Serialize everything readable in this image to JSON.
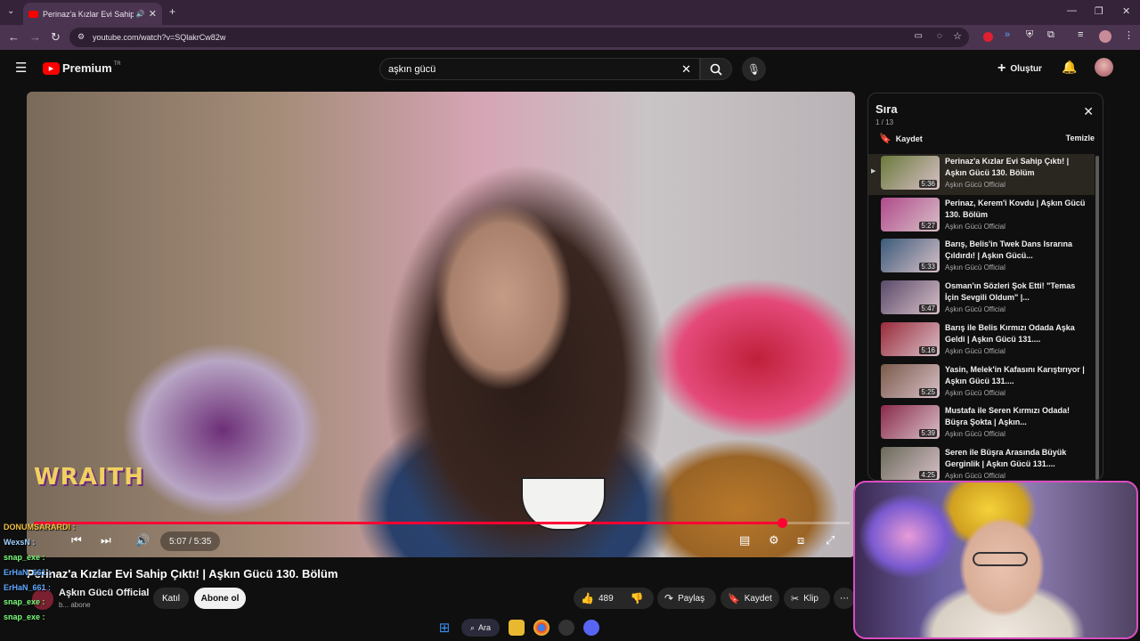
{
  "browser": {
    "tab_title": "Perinaz'a Kızlar Evi Sahip Çıkt",
    "url": "youtube.com/watch?v=SQlakrCw82w"
  },
  "youtube": {
    "logo_text": "Premium",
    "region": "TR",
    "search_value": "aşkın gücü",
    "create_label": "Oluştur"
  },
  "player": {
    "overlay_logo": "WRAITH",
    "time": "5:07 / 5:35",
    "progress": 0.917
  },
  "video": {
    "title": "Perinaz'a Kızlar Evi Sahip Çıktı! | Aşkın Gücü 130. Bölüm",
    "channel": "Aşkın Gücü Official",
    "subscribers": "b... abone",
    "join_label": "Katıl",
    "subscribe_label": "Abone ol",
    "likes": "489",
    "share_label": "Paylaş",
    "save_label": "Kaydet",
    "clip_label": "Klip"
  },
  "chat": [
    {
      "user": "DONUMSARARDI :",
      "color": "#f0c040"
    },
    {
      "user": "WexsN :",
      "color": "#9fd0ff"
    },
    {
      "user": "snap_exe :",
      "color": "#7dff7d"
    },
    {
      "user": "ErHaN_661 :",
      "color": "#5fa8ff"
    },
    {
      "user": "ErHaN_661 :",
      "color": "#5fa8ff"
    },
    {
      "user": "snap_exe :",
      "color": "#7dff7d"
    },
    {
      "user": "snap_exe :",
      "color": "#7dff7d"
    }
  ],
  "playlist": {
    "title": "Sıra",
    "count": "1 / 13",
    "save_label": "Kaydet",
    "clear_label": "Temizle",
    "items": [
      {
        "title": "Perinaz'a Kızlar Evi Sahip Çıktı! | Aşkın Gücü 130. Bölüm",
        "channel": "Aşkın Gücü Official",
        "duration": "5:36",
        "color": "#6a7a3a"
      },
      {
        "title": "Perinaz, Kerem'i Kovdu | Aşkın Gücü 130. Bölüm",
        "channel": "Aşkın Gücü Official",
        "duration": "5:27",
        "color": "#b04a8a"
      },
      {
        "title": "Barış, Belis'in Twek Dans Israrına Çıldırdı! | Aşkın Gücü...",
        "channel": "Aşkın Gücü Official",
        "duration": "5:33",
        "color": "#3a5a7a"
      },
      {
        "title": "Osman'ın Sözleri Şok Etti! \"Temas İçin Sevgili Oldum\" |...",
        "channel": "Aşkın Gücü Official",
        "duration": "5:47",
        "color": "#5a4a6a"
      },
      {
        "title": "Barış ile Belis Kırmızı Odada Aşka Geldi | Aşkın Gücü 131....",
        "channel": "Aşkın Gücü Official",
        "duration": "5:16",
        "color": "#9a2a3a"
      },
      {
        "title": "Yasin, Melek'in Kafasını Karıştırıyor | Aşkın Gücü 131....",
        "channel": "Aşkın Gücü Official",
        "duration": "5:25",
        "color": "#7a5a4a"
      },
      {
        "title": "Mustafa ile Seren Kırmızı Odada! Büşra Şokta | Aşkın...",
        "channel": "Aşkın Gücü Official",
        "duration": "5:39",
        "color": "#8a2a4a"
      },
      {
        "title": "Seren ile Büşra Arasında Büyük Gerginlik | Aşkın Gücü 131....",
        "channel": "Aşkın Gücü Official",
        "duration": "4:25",
        "color": "#6a6a5a"
      }
    ]
  },
  "taskbar": {
    "search_label": "Ara"
  }
}
